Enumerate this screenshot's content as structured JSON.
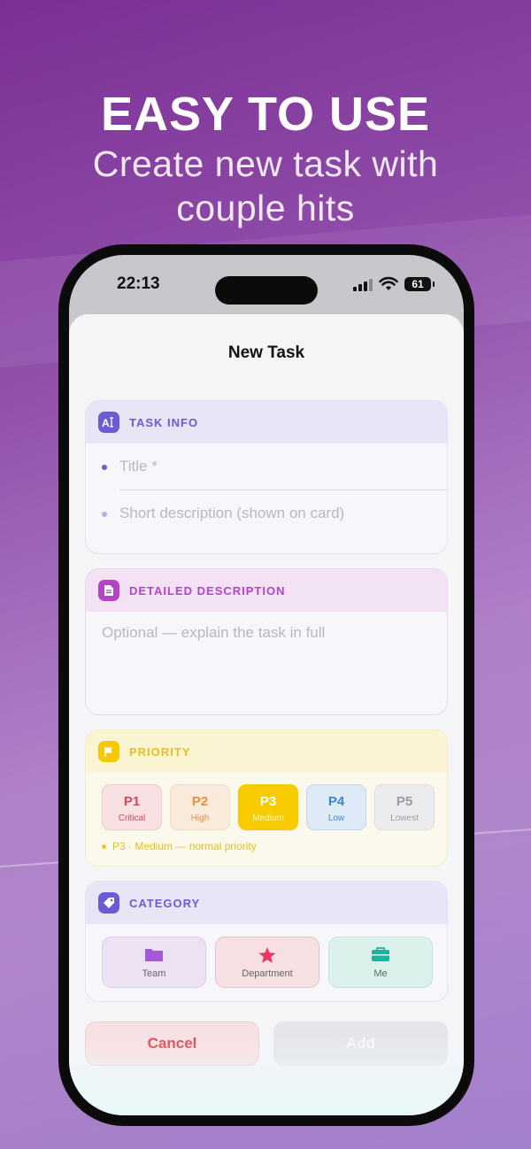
{
  "promo": {
    "headline": "EASY TO USE",
    "subline": "Create new task with couple hits"
  },
  "status_bar": {
    "time": "22:13",
    "battery": "61"
  },
  "sheet": {
    "title": "New Task"
  },
  "task_info": {
    "title": "TASK INFO",
    "icon": "text-cursor-icon",
    "title_placeholder": "Title *",
    "title_value": "",
    "short_desc_placeholder": "Short description (shown on card)",
    "short_desc_value": ""
  },
  "detailed_description": {
    "title": "DETAILED DESCRIPTION",
    "icon": "document-icon",
    "placeholder": "Optional — explain the task in full",
    "value": ""
  },
  "priority": {
    "title": "PRIORITY",
    "icon": "flag-icon",
    "selected": "P3",
    "options": [
      {
        "label": "P1",
        "sub": "Critical",
        "color": "#d9455b",
        "selected": false
      },
      {
        "label": "P2",
        "sub": "High",
        "color": "#e8903a",
        "selected": false
      },
      {
        "label": "P3",
        "sub": "Medium",
        "color": "#f5c800",
        "selected": true
      },
      {
        "label": "P4",
        "sub": "Low",
        "color": "#3a86d6",
        "selected": false
      },
      {
        "label": "P5",
        "sub": "Lowest",
        "color": "#9a9aa0",
        "selected": false
      }
    ],
    "note": "P3 · Medium — normal priority"
  },
  "category": {
    "title": "CATEGORY",
    "icon": "tag-icon",
    "options": [
      {
        "label": "Team",
        "icon": "folder-icon",
        "color": "#a25ad6"
      },
      {
        "label": "Department",
        "icon": "star-icon",
        "color": "#e83a5f"
      },
      {
        "label": "Me",
        "icon": "briefcase-icon",
        "color": "#19b49b"
      }
    ]
  },
  "actions": {
    "cancel": "Cancel",
    "add": "Add"
  },
  "colors": {
    "accent_purple": "#6b5bd6",
    "magenta": "#b542c9",
    "yellow": "#f5c800",
    "cancel_red": "#e0474f"
  }
}
